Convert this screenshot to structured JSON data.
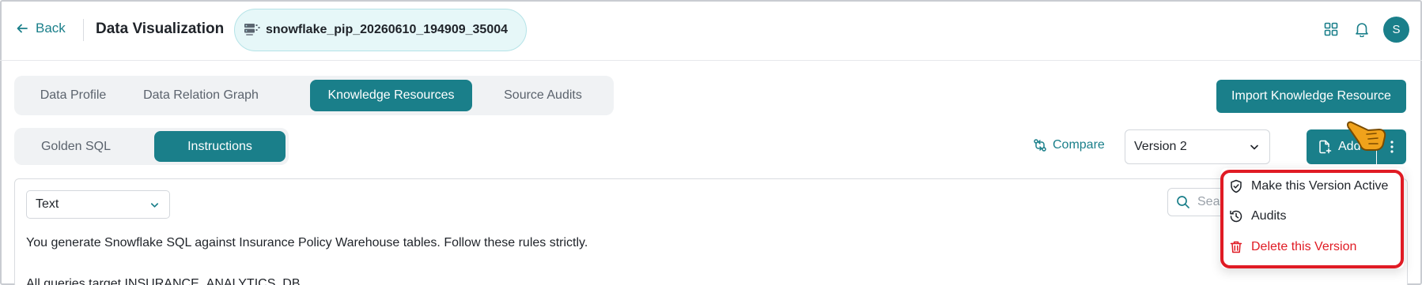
{
  "header": {
    "back_label": "Back",
    "title": "Data Visualization",
    "database_name": "snowflake_pip_20260610_194909_35004",
    "avatar_initial": "S"
  },
  "main_tabs": [
    {
      "label": "Data Profile",
      "active": false
    },
    {
      "label": "Data Relation Graph",
      "active": false
    },
    {
      "label": "Knowledge Resources",
      "active": true
    },
    {
      "label": "Source Audits",
      "active": false
    }
  ],
  "import_button_label": "Import Knowledge Resource",
  "sub_tabs": [
    {
      "label": "Golden SQL",
      "active": false
    },
    {
      "label": "Instructions",
      "active": true
    }
  ],
  "toolbar": {
    "compare_label": "Compare",
    "version_selected": "Version 2",
    "add_label": "Add"
  },
  "content": {
    "type_selected": "Text",
    "search_placeholder": "Search",
    "lines": [
      "You generate Snowflake SQL against Insurance Policy Warehouse tables. Follow these rules strictly.",
      "All queries target INSURANCE_ANALYTICS_DB."
    ]
  },
  "version_menu": {
    "items": [
      {
        "label": "Make this Version Active",
        "icon": "shield-check-icon",
        "danger": false
      },
      {
        "label": "Audits",
        "icon": "history-icon",
        "danger": false
      },
      {
        "label": "Delete this Version",
        "icon": "trash-icon",
        "danger": true
      }
    ]
  },
  "colors": {
    "accent": "#1a7f8a",
    "danger": "#e01b24",
    "highlight_outline": "#e01b24"
  }
}
